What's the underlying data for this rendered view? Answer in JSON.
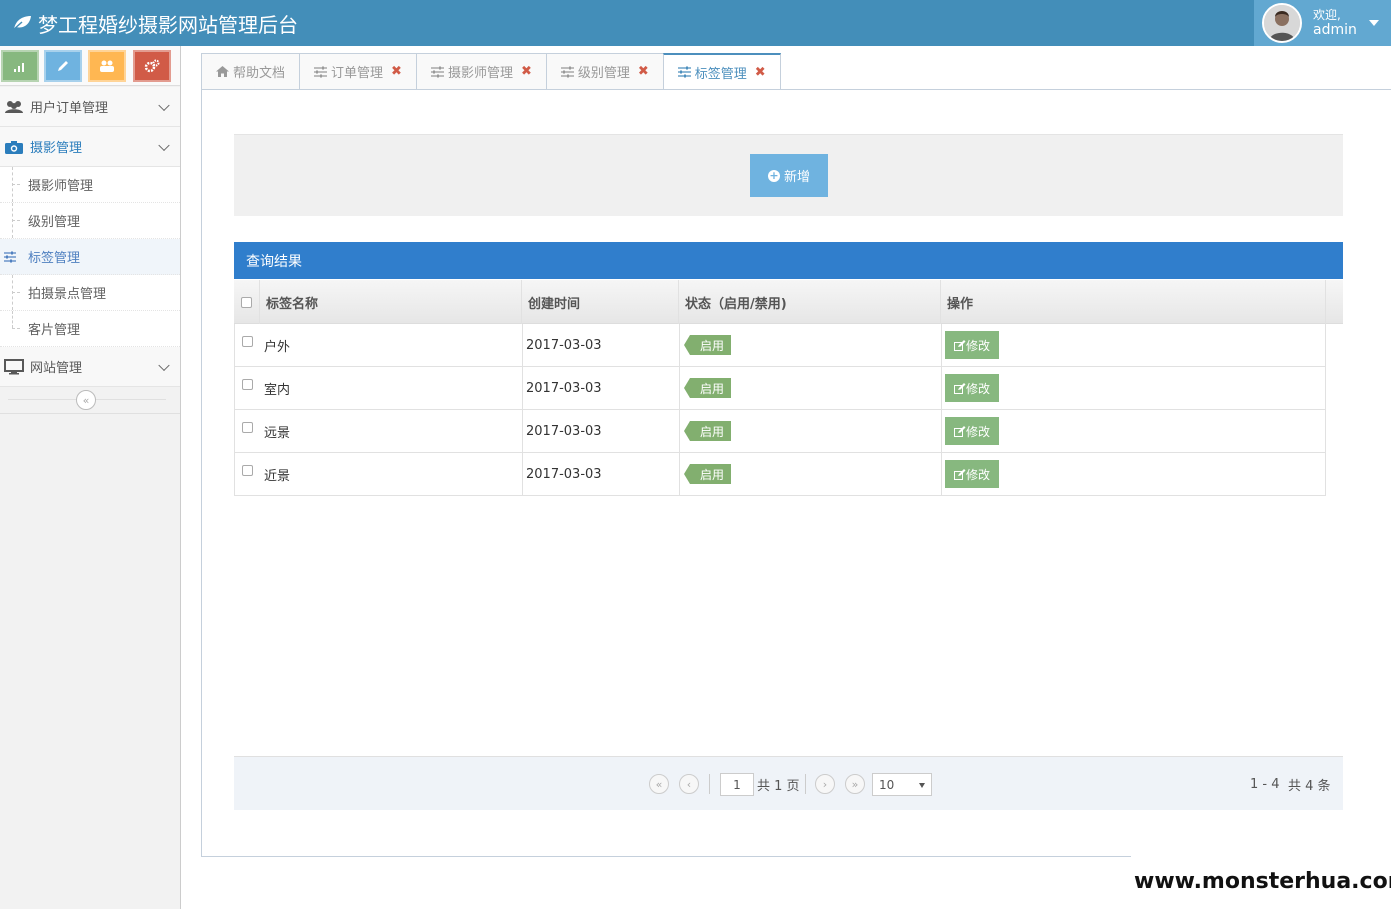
{
  "header": {
    "title": "梦工程婚纱摄影网站管理后台",
    "welcome": "欢迎,",
    "username": "admin",
    "brand_color": "#438eb9"
  },
  "shortcuts": [
    {
      "icon": "signal-icon",
      "color": "#87b87f"
    },
    {
      "icon": "pencil-icon",
      "color": "#6fb3e0"
    },
    {
      "icon": "group-icon",
      "color": "#ffb752"
    },
    {
      "icon": "cogs-icon",
      "color": "#d15b47"
    }
  ],
  "sidebar": {
    "menus": [
      {
        "label": "用户订单管理",
        "icon": "users-icon"
      },
      {
        "label": "摄影管理",
        "icon": "camera-icon"
      },
      {
        "label": "网站管理",
        "icon": "desktop-icon"
      }
    ],
    "sub_items": [
      "摄影师管理",
      "级别管理",
      "标签管理",
      "拍摄景点管理",
      "客片管理"
    ],
    "collapse": "«"
  },
  "tabs": [
    {
      "label": "帮助文档",
      "icon": "home-icon",
      "closable": false
    },
    {
      "label": "订单管理",
      "icon": "sliders-icon",
      "closable": true
    },
    {
      "label": "摄影师管理",
      "icon": "sliders-icon",
      "closable": true
    },
    {
      "label": "级别管理",
      "icon": "sliders-icon",
      "closable": true
    },
    {
      "label": "标签管理",
      "icon": "sliders-icon",
      "closable": true
    }
  ],
  "close_symbol": "✖",
  "toolbar": {
    "add_label": "新增"
  },
  "results": {
    "title": "查询结果",
    "columns": [
      "标签名称",
      "创建时间",
      "状态（启用/禁用)",
      "操作"
    ],
    "rows": [
      {
        "name": "户外",
        "created": "2017-03-03",
        "status": "启用",
        "action": "修改"
      },
      {
        "name": "室内",
        "created": "2017-03-03",
        "status": "启用",
        "action": "修改"
      },
      {
        "name": "远景",
        "created": "2017-03-03",
        "status": "启用",
        "action": "修改"
      },
      {
        "name": "近景",
        "created": "2017-03-03",
        "status": "启用",
        "action": "修改"
      }
    ]
  },
  "pager": {
    "first": "«",
    "prev": "‹",
    "next": "›",
    "last": "»",
    "page": "1",
    "total_pages": "共 1 页",
    "page_size": "10",
    "range": "1 - 4",
    "total_records": "共 4 条"
  },
  "watermark": "www.monsterhua.com"
}
